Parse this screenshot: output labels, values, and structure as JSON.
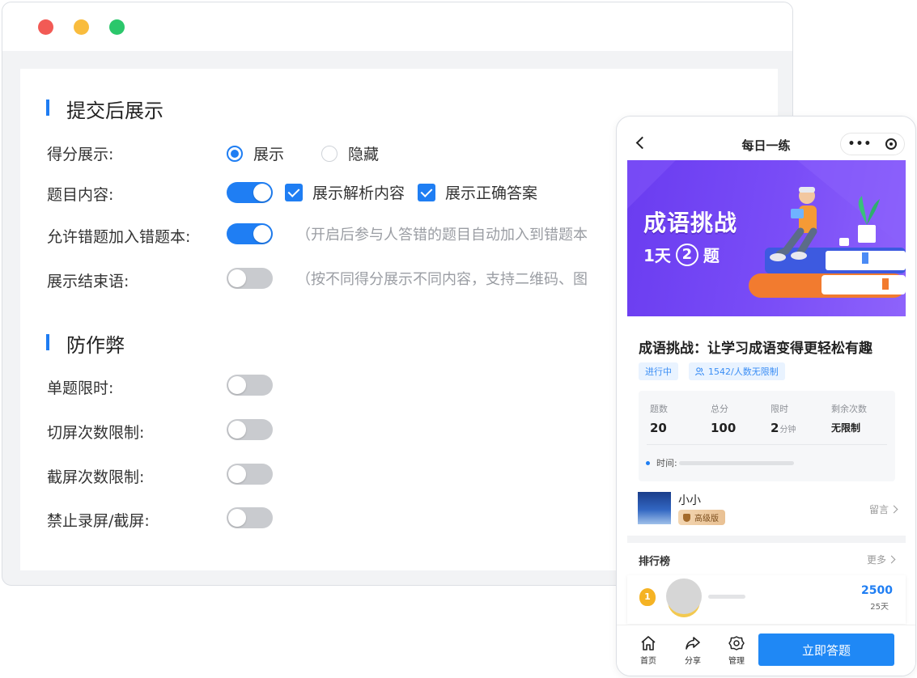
{
  "window": {
    "sections": [
      {
        "title": "提交后展示"
      },
      {
        "title": "防作弊"
      }
    ],
    "score_display": {
      "label": "得分展示:",
      "options": [
        "展示",
        "隐藏"
      ],
      "selected": "展示"
    },
    "question_content": {
      "label": "题目内容:",
      "toggle_on": true,
      "checkbox_1": "展示解析内容",
      "checkbox_2": "展示正确答案"
    },
    "wrong_book": {
      "label": "允许错题加入错题本:",
      "toggle_on": true,
      "hint": "（开启后参与人答错的题目自动加入到错题本"
    },
    "end_message": {
      "label": "展示结束语:",
      "toggle_on": false,
      "hint": "（按不同得分展示不同内容，支持二维码、图"
    },
    "time_limit": {
      "label": "单题限时:",
      "toggle_on": false
    },
    "switch_limit": {
      "label": "切屏次数限制:",
      "toggle_on": false
    },
    "screenshot_limit": {
      "label": "截屏次数限制:",
      "toggle_on": false
    },
    "no_record": {
      "label": "禁止录屏/截屏:",
      "toggle_on": false
    }
  },
  "phone": {
    "title": "每日一练",
    "capsule_more": "•••",
    "banner": {
      "title": "成语挑战",
      "sub_prefix": "1天",
      "sub_num": "2",
      "sub_suffix": "题"
    },
    "detail_title": "成语挑战：让学习成语变得更轻松有趣",
    "tags": [
      "进行中",
      "1542/人数无限制"
    ],
    "stats": [
      {
        "key": "题数",
        "value": "20",
        "unit": ""
      },
      {
        "key": "总分",
        "value": "100",
        "unit": ""
      },
      {
        "key": "限时",
        "value": "2",
        "unit": "分钟"
      },
      {
        "key": "剩余次数",
        "value": "无限制",
        "unit": ""
      }
    ],
    "time_label": "时间:",
    "author": {
      "name": "小小",
      "level": "高级版",
      "message": "留言"
    },
    "ranking": {
      "title": "排行榜",
      "more": "更多",
      "rank_badge": "1",
      "score": "2500",
      "days": "25天"
    },
    "tabbar": {
      "home": "首页",
      "share": "分享",
      "manage": "管理",
      "start": "立即答题"
    }
  },
  "colors": {
    "accent": "#1f7ef3",
    "banner": "#7a4df7",
    "toggle_off": "#c9cbcf"
  }
}
